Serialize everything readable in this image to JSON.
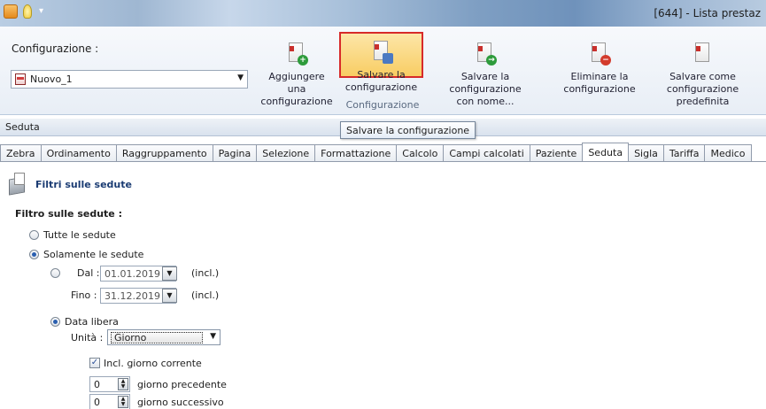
{
  "window": {
    "title": "[644] - Lista prestaz"
  },
  "ribbon": {
    "config_label": "Configurazione :",
    "config_value": "Nuovo_1",
    "buttons": {
      "add": [
        "Aggiungere una",
        "configurazione"
      ],
      "save": [
        "Salvare la",
        "configurazione"
      ],
      "save_as": [
        "Salvare la configurazione",
        "con nome..."
      ],
      "delete": [
        "Eliminare la",
        "configurazione"
      ],
      "default": [
        "Salvare come",
        "configurazione predefinita"
      ]
    },
    "group_label": "Configurazione"
  },
  "tooltip": "Salvare la configurazione",
  "section_title": "Seduta",
  "tabs": [
    "Zebra",
    "Ordinamento",
    "Raggruppamento",
    "Pagina",
    "Selezione",
    "Formattazione",
    "Calcolo",
    "Campi calcolati",
    "Paziente",
    "Seduta",
    "Sigla",
    "Tariffa",
    "Medico"
  ],
  "active_tab": "Seduta",
  "panel": {
    "title": "Filtri sulle sedute",
    "filter_title": "Filtro sulle sedute :",
    "all_sessions": "Tutte le sedute",
    "only_sessions": "Solamente le sedute",
    "from_label": "Dal :",
    "from_value": "01.01.2019",
    "to_label": "Fino :",
    "to_value": "31.12.2019",
    "incl": "(incl.)",
    "free_date": "Data libera",
    "unit_label": "Unità :",
    "unit_value": "Giorno",
    "include_today": "Incl. giorno corrente",
    "prev_value": "0",
    "prev_label": "giorno precedente",
    "next_value": "0",
    "next_label": "giorno successivo"
  },
  "colors": {
    "highlight_border": "#d72a2a",
    "highlight_fill": "#f8cd63",
    "panel_title": "#1b3c73"
  }
}
